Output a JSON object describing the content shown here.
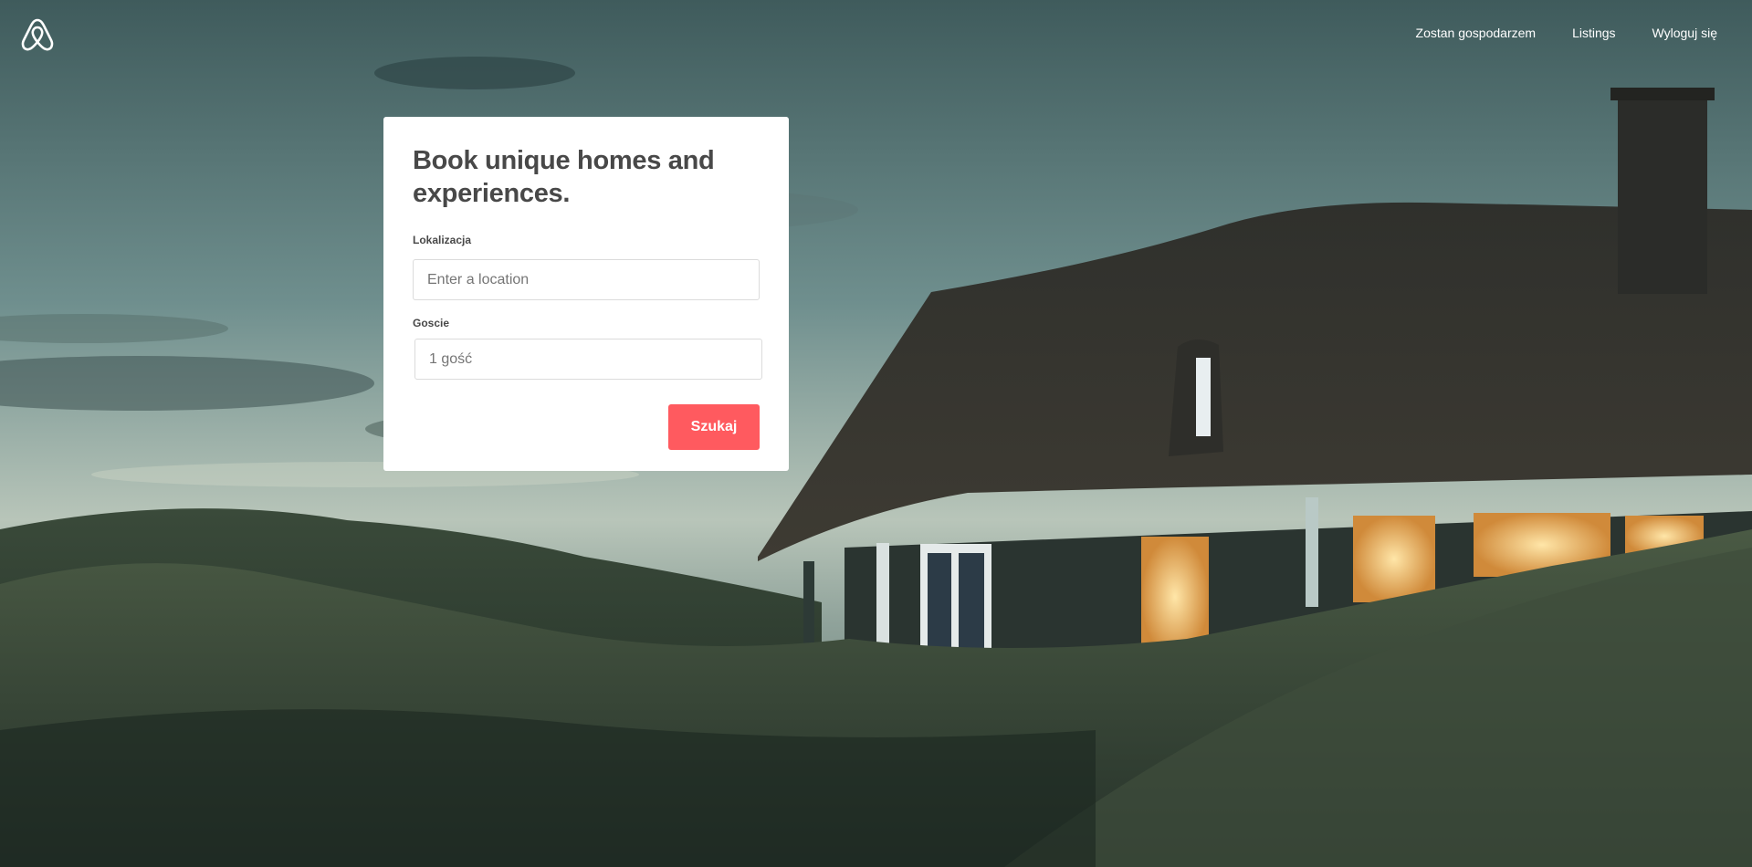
{
  "nav": {
    "host_link": "Zostan gospodarzem",
    "listings_link": "Listings",
    "logout_link": "Wyloguj się"
  },
  "search_card": {
    "title": "Book unique homes and experiences.",
    "location_label": "Lokalizacja",
    "location_placeholder": "Enter a location",
    "location_value": "",
    "guests_label": "Goscie",
    "guests_placeholder": "1 gość",
    "guests_value": "",
    "submit_label": "Szukaj"
  },
  "colors": {
    "accent": "#ff5a5f",
    "text": "#484848",
    "card_bg": "#ffffff"
  },
  "icons": {
    "logo": "airbnb-belo-logo-icon"
  }
}
